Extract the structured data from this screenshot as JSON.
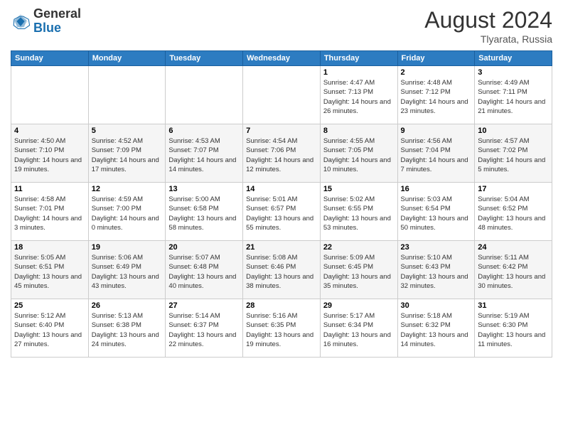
{
  "header": {
    "logo": {
      "general": "General",
      "blue": "Blue"
    },
    "title": "August 2024",
    "location": "Tlyarata, Russia"
  },
  "days_of_week": [
    "Sunday",
    "Monday",
    "Tuesday",
    "Wednesday",
    "Thursday",
    "Friday",
    "Saturday"
  ],
  "weeks": [
    [
      null,
      null,
      null,
      null,
      {
        "day": "1",
        "sunrise": "Sunrise: 4:47 AM",
        "sunset": "Sunset: 7:13 PM",
        "daylight": "Daylight: 14 hours and 26 minutes."
      },
      {
        "day": "2",
        "sunrise": "Sunrise: 4:48 AM",
        "sunset": "Sunset: 7:12 PM",
        "daylight": "Daylight: 14 hours and 23 minutes."
      },
      {
        "day": "3",
        "sunrise": "Sunrise: 4:49 AM",
        "sunset": "Sunset: 7:11 PM",
        "daylight": "Daylight: 14 hours and 21 minutes."
      }
    ],
    [
      {
        "day": "4",
        "sunrise": "Sunrise: 4:50 AM",
        "sunset": "Sunset: 7:10 PM",
        "daylight": "Daylight: 14 hours and 19 minutes."
      },
      {
        "day": "5",
        "sunrise": "Sunrise: 4:52 AM",
        "sunset": "Sunset: 7:09 PM",
        "daylight": "Daylight: 14 hours and 17 minutes."
      },
      {
        "day": "6",
        "sunrise": "Sunrise: 4:53 AM",
        "sunset": "Sunset: 7:07 PM",
        "daylight": "Daylight: 14 hours and 14 minutes."
      },
      {
        "day": "7",
        "sunrise": "Sunrise: 4:54 AM",
        "sunset": "Sunset: 7:06 PM",
        "daylight": "Daylight: 14 hours and 12 minutes."
      },
      {
        "day": "8",
        "sunrise": "Sunrise: 4:55 AM",
        "sunset": "Sunset: 7:05 PM",
        "daylight": "Daylight: 14 hours and 10 minutes."
      },
      {
        "day": "9",
        "sunrise": "Sunrise: 4:56 AM",
        "sunset": "Sunset: 7:04 PM",
        "daylight": "Daylight: 14 hours and 7 minutes."
      },
      {
        "day": "10",
        "sunrise": "Sunrise: 4:57 AM",
        "sunset": "Sunset: 7:02 PM",
        "daylight": "Daylight: 14 hours and 5 minutes."
      }
    ],
    [
      {
        "day": "11",
        "sunrise": "Sunrise: 4:58 AM",
        "sunset": "Sunset: 7:01 PM",
        "daylight": "Daylight: 14 hours and 3 minutes."
      },
      {
        "day": "12",
        "sunrise": "Sunrise: 4:59 AM",
        "sunset": "Sunset: 7:00 PM",
        "daylight": "Daylight: 14 hours and 0 minutes."
      },
      {
        "day": "13",
        "sunrise": "Sunrise: 5:00 AM",
        "sunset": "Sunset: 6:58 PM",
        "daylight": "Daylight: 13 hours and 58 minutes."
      },
      {
        "day": "14",
        "sunrise": "Sunrise: 5:01 AM",
        "sunset": "Sunset: 6:57 PM",
        "daylight": "Daylight: 13 hours and 55 minutes."
      },
      {
        "day": "15",
        "sunrise": "Sunrise: 5:02 AM",
        "sunset": "Sunset: 6:55 PM",
        "daylight": "Daylight: 13 hours and 53 minutes."
      },
      {
        "day": "16",
        "sunrise": "Sunrise: 5:03 AM",
        "sunset": "Sunset: 6:54 PM",
        "daylight": "Daylight: 13 hours and 50 minutes."
      },
      {
        "day": "17",
        "sunrise": "Sunrise: 5:04 AM",
        "sunset": "Sunset: 6:52 PM",
        "daylight": "Daylight: 13 hours and 48 minutes."
      }
    ],
    [
      {
        "day": "18",
        "sunrise": "Sunrise: 5:05 AM",
        "sunset": "Sunset: 6:51 PM",
        "daylight": "Daylight: 13 hours and 45 minutes."
      },
      {
        "day": "19",
        "sunrise": "Sunrise: 5:06 AM",
        "sunset": "Sunset: 6:49 PM",
        "daylight": "Daylight: 13 hours and 43 minutes."
      },
      {
        "day": "20",
        "sunrise": "Sunrise: 5:07 AM",
        "sunset": "Sunset: 6:48 PM",
        "daylight": "Daylight: 13 hours and 40 minutes."
      },
      {
        "day": "21",
        "sunrise": "Sunrise: 5:08 AM",
        "sunset": "Sunset: 6:46 PM",
        "daylight": "Daylight: 13 hours and 38 minutes."
      },
      {
        "day": "22",
        "sunrise": "Sunrise: 5:09 AM",
        "sunset": "Sunset: 6:45 PM",
        "daylight": "Daylight: 13 hours and 35 minutes."
      },
      {
        "day": "23",
        "sunrise": "Sunrise: 5:10 AM",
        "sunset": "Sunset: 6:43 PM",
        "daylight": "Daylight: 13 hours and 32 minutes."
      },
      {
        "day": "24",
        "sunrise": "Sunrise: 5:11 AM",
        "sunset": "Sunset: 6:42 PM",
        "daylight": "Daylight: 13 hours and 30 minutes."
      }
    ],
    [
      {
        "day": "25",
        "sunrise": "Sunrise: 5:12 AM",
        "sunset": "Sunset: 6:40 PM",
        "daylight": "Daylight: 13 hours and 27 minutes."
      },
      {
        "day": "26",
        "sunrise": "Sunrise: 5:13 AM",
        "sunset": "Sunset: 6:38 PM",
        "daylight": "Daylight: 13 hours and 24 minutes."
      },
      {
        "day": "27",
        "sunrise": "Sunrise: 5:14 AM",
        "sunset": "Sunset: 6:37 PM",
        "daylight": "Daylight: 13 hours and 22 minutes."
      },
      {
        "day": "28",
        "sunrise": "Sunrise: 5:16 AM",
        "sunset": "Sunset: 6:35 PM",
        "daylight": "Daylight: 13 hours and 19 minutes."
      },
      {
        "day": "29",
        "sunrise": "Sunrise: 5:17 AM",
        "sunset": "Sunset: 6:34 PM",
        "daylight": "Daylight: 13 hours and 16 minutes."
      },
      {
        "day": "30",
        "sunrise": "Sunrise: 5:18 AM",
        "sunset": "Sunset: 6:32 PM",
        "daylight": "Daylight: 13 hours and 14 minutes."
      },
      {
        "day": "31",
        "sunrise": "Sunrise: 5:19 AM",
        "sunset": "Sunset: 6:30 PM",
        "daylight": "Daylight: 13 hours and 11 minutes."
      }
    ]
  ]
}
